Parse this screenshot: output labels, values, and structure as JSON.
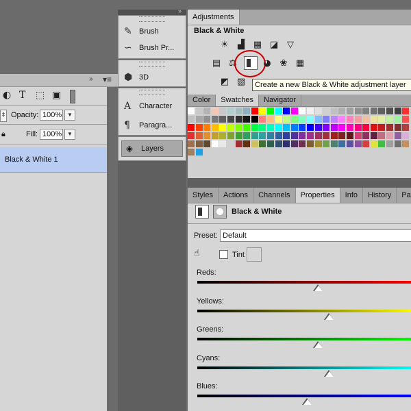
{
  "layers": {
    "opacity_label": "Opacity:",
    "opacity_value": "100%",
    "fill_label": "Fill:",
    "fill_value": "100%",
    "layer_name": "Black & White 1"
  },
  "dock": {
    "items": [
      {
        "label": "Brush",
        "icon": "brush-icon"
      },
      {
        "label": "Brush Pr...",
        "icon": "brush-presets-icon"
      },
      {
        "label": "3D",
        "icon": "cube-icon"
      },
      {
        "label": "Character",
        "icon": "character-icon"
      },
      {
        "label": "Paragra...",
        "icon": "paragraph-icon"
      },
      {
        "label": "Layers",
        "icon": "layers-icon"
      }
    ]
  },
  "adjustments": {
    "tab": "Adjustments",
    "current": "Black & White",
    "tooltip": "Create a new Black & White adjustment layer"
  },
  "swatch_tabs": [
    "Color",
    "Swatches",
    "Navigator"
  ],
  "prop_tabs": [
    "Styles",
    "Actions",
    "Channels",
    "Properties",
    "Info",
    "History",
    "Paths"
  ],
  "properties": {
    "title": "Black & White",
    "preset_label": "Preset:",
    "preset_value": "Default",
    "tint_label": "Tint"
  },
  "sliders": [
    {
      "label": "Reds:",
      "value": 0.55
    },
    {
      "label": "Yellows:",
      "value": 0.6
    },
    {
      "label": "Greens:",
      "value": 0.55
    },
    {
      "label": "Cyans:",
      "value": 0.6
    },
    {
      "label": "Blues:",
      "value": 0.5
    }
  ],
  "colors": {
    "selected_layer": "#b9cdf2",
    "tooltip_bg": "#fffff0",
    "highlight_ring": "#cc0000"
  }
}
